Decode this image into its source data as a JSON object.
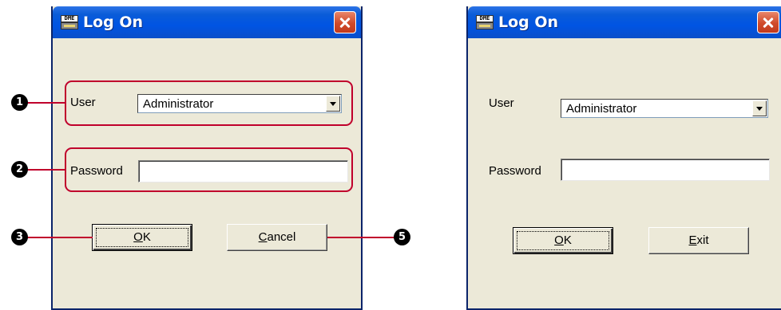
{
  "left_dialog": {
    "icon_text": "DME",
    "title": "Log On",
    "user_label": "User",
    "user_value": "Administrator",
    "password_label": "Password",
    "password_value": "",
    "ok_prefix": "",
    "ok_mnemonic": "O",
    "ok_rest": "K",
    "cancel_prefix": "",
    "cancel_mnemonic": "C",
    "cancel_rest": "ancel"
  },
  "right_dialog": {
    "icon_text": "DME",
    "title": "Log On",
    "user_label": "User",
    "user_value": "Administrator",
    "password_label": "Password",
    "password_value": "",
    "ok_mnemonic": "O",
    "ok_rest": "K",
    "exit_mnemonic": "E",
    "exit_rest": "xit"
  },
  "callouts": {
    "marker_1": "1",
    "marker_2": "2",
    "marker_3": "3",
    "marker_5": "5"
  },
  "colors": {
    "callout": "#c0002c",
    "titlebar": "#0054e3",
    "dialog_bg": "#ece9d8"
  }
}
